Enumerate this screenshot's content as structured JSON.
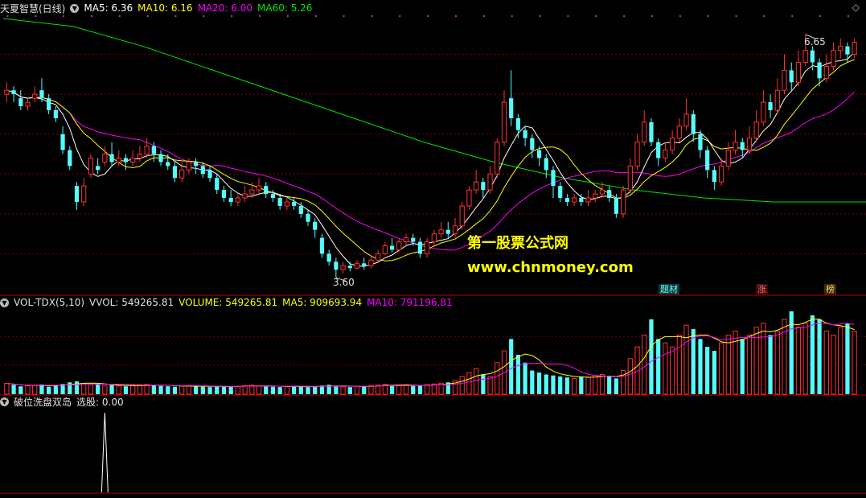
{
  "header": {
    "title": "天夏智慧(日线)",
    "ma5": "MA5: 6.36",
    "ma10": "MA10: 6.16",
    "ma20": "MA20: 6.00",
    "ma60": "MA60: 5.26"
  },
  "volume_header": {
    "title": "VOL-TDX(5,10)",
    "vvol": "VVOL: 549265.81",
    "volume": "VOLUME: 549265.81",
    "ma5": "MA5: 909693.94",
    "ma10": "MA10: 791196.81"
  },
  "indicator_header": {
    "title": "破位洗盘双岛",
    "value": "选股: 0.00"
  },
  "annotations": {
    "high": "6.65",
    "low": "3.60",
    "watermark_title": "第一股票公式网",
    "watermark_url": "www.chnmoney.com",
    "tag1": "题材",
    "tag2": "涨",
    "tag3": "榜"
  },
  "colors": {
    "up": "#ff3232",
    "down": "#54fcfc",
    "ma5": "#ffffff",
    "ma10": "#ffff00",
    "ma20": "#ff00ff",
    "ma60": "#00e600",
    "grid": "#7a0000"
  },
  "chart_data": {
    "type": "candlestick",
    "price_range": [
      3.4,
      6.9
    ],
    "candles": [
      [
        5.9,
        5.95,
        6.05,
        5.8
      ],
      [
        5.95,
        5.9,
        6.0,
        5.8
      ],
      [
        5.85,
        5.75,
        5.95,
        5.7
      ],
      [
        5.75,
        5.8,
        5.85,
        5.7
      ],
      [
        5.85,
        5.9,
        6.0,
        5.8
      ],
      [
        5.95,
        5.85,
        6.1,
        5.8
      ],
      [
        5.85,
        5.7,
        5.9,
        5.65
      ],
      [
        5.7,
        5.6,
        5.75,
        5.55
      ],
      [
        5.4,
        5.2,
        5.5,
        5.15
      ],
      [
        5.2,
        5.0,
        5.25,
        4.95
      ],
      [
        4.75,
        4.55,
        4.8,
        4.45
      ],
      [
        4.55,
        4.75,
        4.85,
        4.5
      ],
      [
        4.9,
        5.1,
        5.15,
        4.85
      ],
      [
        5.0,
        4.95,
        5.1,
        4.9
      ],
      [
        5.05,
        5.15,
        5.25,
        5.0
      ],
      [
        5.15,
        5.05,
        5.3,
        5.0
      ],
      [
        5.05,
        5.1,
        5.2,
        5.0
      ],
      [
        5.1,
        5.05,
        5.15,
        4.95
      ],
      [
        5.05,
        5.1,
        5.2,
        5.0
      ],
      [
        5.1,
        5.15,
        5.25,
        5.05
      ],
      [
        5.15,
        5.25,
        5.35,
        5.1
      ],
      [
        5.25,
        5.15,
        5.3,
        5.05
      ],
      [
        5.15,
        5.05,
        5.2,
        5.0
      ],
      [
        5.05,
        5.0,
        5.15,
        4.95
      ],
      [
        5.0,
        4.85,
        5.05,
        4.8
      ],
      [
        4.85,
        4.95,
        5.05,
        4.8
      ],
      [
        4.95,
        5.05,
        5.1,
        4.9
      ],
      [
        5.05,
        5.0,
        5.1,
        4.9
      ],
      [
        5.0,
        4.9,
        5.05,
        4.85
      ],
      [
        4.95,
        4.85,
        5.0,
        4.8
      ],
      [
        4.85,
        4.7,
        4.9,
        4.65
      ],
      [
        4.7,
        4.6,
        4.75,
        4.55
      ],
      [
        4.6,
        4.55,
        4.7,
        4.5
      ],
      [
        4.55,
        4.6,
        4.65,
        4.5
      ],
      [
        4.6,
        4.65,
        4.75,
        4.55
      ],
      [
        4.65,
        4.7,
        4.8,
        4.6
      ],
      [
        4.7,
        4.75,
        4.85,
        4.65
      ],
      [
        4.75,
        4.65,
        4.8,
        4.6
      ],
      [
        4.65,
        4.6,
        4.7,
        4.55
      ],
      [
        4.6,
        4.5,
        4.65,
        4.45
      ],
      [
        4.5,
        4.55,
        4.6,
        4.45
      ],
      [
        4.55,
        4.5,
        4.6,
        4.45
      ],
      [
        4.5,
        4.4,
        4.55,
        4.35
      ],
      [
        4.4,
        4.3,
        4.45,
        4.25
      ],
      [
        4.3,
        4.2,
        4.35,
        4.1
      ],
      [
        4.1,
        3.9,
        4.15,
        3.85
      ],
      [
        3.9,
        3.8,
        3.95,
        3.75
      ],
      [
        3.8,
        3.7,
        3.85,
        3.6
      ],
      [
        3.7,
        3.75,
        3.8,
        3.65
      ],
      [
        3.75,
        3.72,
        3.8,
        3.68
      ],
      [
        3.72,
        3.78,
        3.82,
        3.7
      ],
      [
        3.78,
        3.75,
        3.85,
        3.7
      ],
      [
        3.75,
        3.82,
        3.88,
        3.72
      ],
      [
        3.82,
        3.9,
        3.95,
        3.8
      ],
      [
        3.9,
        4.0,
        4.05,
        3.88
      ],
      [
        4.0,
        3.95,
        4.1,
        3.92
      ],
      [
        3.95,
        4.05,
        4.1,
        3.92
      ],
      [
        4.05,
        4.1,
        4.15,
        4.0
      ],
      [
        4.1,
        4.05,
        4.15,
        4.0
      ],
      [
        4.05,
        3.9,
        4.1,
        3.85
      ],
      [
        3.9,
        4.05,
        4.1,
        3.85
      ],
      [
        4.05,
        4.15,
        4.2,
        4.0
      ],
      [
        4.15,
        4.2,
        4.3,
        4.1
      ],
      [
        4.2,
        4.15,
        4.3,
        4.1
      ],
      [
        4.15,
        4.25,
        4.35,
        4.1
      ],
      [
        4.25,
        4.5,
        4.55,
        4.2
      ],
      [
        4.5,
        4.7,
        4.75,
        4.45
      ],
      [
        4.7,
        4.8,
        4.95,
        4.65
      ],
      [
        4.8,
        4.7,
        4.85,
        4.6
      ],
      [
        4.7,
        4.9,
        5.0,
        4.65
      ],
      [
        4.9,
        5.3,
        5.35,
        4.85
      ],
      [
        5.3,
        5.8,
        5.95,
        5.25
      ],
      [
        5.85,
        5.6,
        6.2,
        5.5
      ],
      [
        5.6,
        5.45,
        5.65,
        5.35
      ],
      [
        5.45,
        5.35,
        5.5,
        5.25
      ],
      [
        5.35,
        5.2,
        5.4,
        5.1
      ],
      [
        5.2,
        5.1,
        5.25,
        5.0
      ],
      [
        5.1,
        4.95,
        5.15,
        4.85
      ],
      [
        4.95,
        4.75,
        5.0,
        4.6
      ],
      [
        4.75,
        4.6,
        4.8,
        4.55
      ],
      [
        4.6,
        4.55,
        4.65,
        4.5
      ],
      [
        4.55,
        4.6,
        4.65,
        4.5
      ],
      [
        4.6,
        4.55,
        4.65,
        4.5
      ],
      [
        4.55,
        4.6,
        4.7,
        4.5
      ],
      [
        4.6,
        4.65,
        4.7,
        4.55
      ],
      [
        4.65,
        4.7,
        4.8,
        4.6
      ],
      [
        4.7,
        4.6,
        4.75,
        4.55
      ],
      [
        4.6,
        4.4,
        4.65,
        4.35
      ],
      [
        4.4,
        4.7,
        4.75,
        4.35
      ],
      [
        4.7,
        5.0,
        5.1,
        4.65
      ],
      [
        5.0,
        5.3,
        5.4,
        4.95
      ],
      [
        5.3,
        5.55,
        5.7,
        5.25
      ],
      [
        5.55,
        5.3,
        5.6,
        5.25
      ],
      [
        5.3,
        5.1,
        5.35,
        5.0
      ],
      [
        5.1,
        5.2,
        5.3,
        5.05
      ],
      [
        5.2,
        5.35,
        5.45,
        5.15
      ],
      [
        5.35,
        5.5,
        5.6,
        5.3
      ],
      [
        5.5,
        5.65,
        5.85,
        5.45
      ],
      [
        5.65,
        5.4,
        5.7,
        5.3
      ],
      [
        5.4,
        5.2,
        5.45,
        5.1
      ],
      [
        5.2,
        4.95,
        5.25,
        4.85
      ],
      [
        4.95,
        4.8,
        5.0,
        4.7
      ],
      [
        4.8,
        5.0,
        5.1,
        4.75
      ],
      [
        5.0,
        5.2,
        5.3,
        4.95
      ],
      [
        5.2,
        5.3,
        5.45,
        5.15
      ],
      [
        5.3,
        5.2,
        5.35,
        5.1
      ],
      [
        5.2,
        5.35,
        5.5,
        5.15
      ],
      [
        5.35,
        5.55,
        5.7,
        5.3
      ],
      [
        5.55,
        5.8,
        5.95,
        5.5
      ],
      [
        5.8,
        5.7,
        5.9,
        5.6
      ],
      [
        5.7,
        5.95,
        6.1,
        5.65
      ],
      [
        5.95,
        6.2,
        6.4,
        5.9
      ],
      [
        6.2,
        6.05,
        6.3,
        5.95
      ],
      [
        6.05,
        6.3,
        6.45,
        6.0
      ],
      [
        6.3,
        6.45,
        6.65,
        6.25
      ],
      [
        6.45,
        6.3,
        6.5,
        6.2
      ],
      [
        6.3,
        6.1,
        6.35,
        6.0
      ],
      [
        6.1,
        6.25,
        6.4,
        6.05
      ],
      [
        6.25,
        6.45,
        6.55,
        6.2
      ],
      [
        6.45,
        6.5,
        6.6,
        6.35
      ],
      [
        6.5,
        6.4,
        6.55,
        6.3
      ],
      [
        6.4,
        6.55,
        6.6,
        6.35
      ]
    ],
    "volume": [
      55,
      48,
      40,
      42,
      45,
      50,
      38,
      46,
      52,
      60,
      65,
      55,
      48,
      50,
      44,
      46,
      42,
      40,
      45,
      48,
      50,
      46,
      42,
      40,
      38,
      42,
      44,
      40,
      38,
      36,
      40,
      42,
      38,
      40,
      44,
      46,
      42,
      40,
      38,
      36,
      40,
      42,
      38,
      36,
      40,
      44,
      48,
      40,
      38,
      36,
      40,
      42,
      44,
      46,
      50,
      44,
      46,
      48,
      42,
      44,
      48,
      52,
      56,
      60,
      70,
      90,
      110,
      130,
      100,
      90,
      160,
      220,
      280,
      200,
      160,
      120,
      110,
      100,
      95,
      90,
      85,
      80,
      90,
      85,
      95,
      100,
      90,
      80,
      120,
      180,
      240,
      300,
      380,
      280,
      260,
      240,
      300,
      350,
      330,
      280,
      240,
      220,
      260,
      300,
      320,
      280,
      300,
      340,
      360,
      300,
      320,
      380,
      420,
      340,
      360,
      400,
      380,
      320,
      300,
      340,
      360,
      320
    ],
    "ma60_knots": [
      [
        0,
        6.85
      ],
      [
        10,
        6.75
      ],
      [
        20,
        6.5
      ],
      [
        30,
        6.2
      ],
      [
        40,
        5.9
      ],
      [
        50,
        5.6
      ],
      [
        60,
        5.3
      ],
      [
        70,
        5.05
      ],
      [
        80,
        4.85
      ],
      [
        90,
        4.7
      ],
      [
        100,
        4.6
      ],
      [
        110,
        4.55
      ],
      [
        120,
        4.55
      ],
      [
        130,
        4.55
      ],
      [
        140,
        4.6
      ],
      [
        150,
        4.7
      ],
      [
        160,
        4.9
      ],
      [
        168,
        5.1
      ]
    ],
    "indicator_spike_index": 14
  }
}
